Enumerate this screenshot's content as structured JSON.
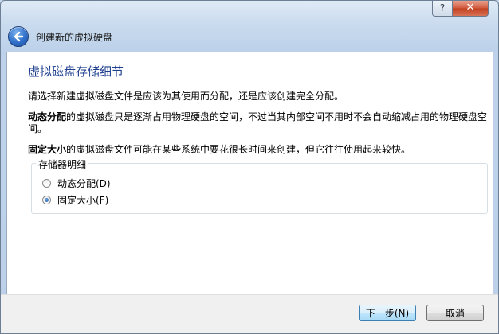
{
  "titlebar": {
    "help_label": "?",
    "close_label": "✕"
  },
  "nav": {
    "title": "创建新的虚拟硬盘"
  },
  "content": {
    "heading": "虚拟磁盘存储细节",
    "intro": "请选择新建虚拟磁盘文件是应该为其使用而分配，还是应该创建完全分配。",
    "dynamic_bold": "动态分配",
    "dynamic_desc": "的虚拟磁盘只是逐渐占用物理硬盘的空间，不过当其内部空间不用时不会自动缩减占用的物理硬盘空间。",
    "fixed_bold": "固定大小",
    "fixed_desc": "的虚拟磁盘文件可能在某些系统中要花很长时间来创建，但它往往使用起来较快。",
    "group_title": "存储器明细",
    "options": [
      {
        "label": "动态分配(D)",
        "checked": false
      },
      {
        "label": "固定大小(F)",
        "checked": true
      }
    ]
  },
  "footer": {
    "next_label": "下一步(N)",
    "cancel_label": "取消"
  }
}
